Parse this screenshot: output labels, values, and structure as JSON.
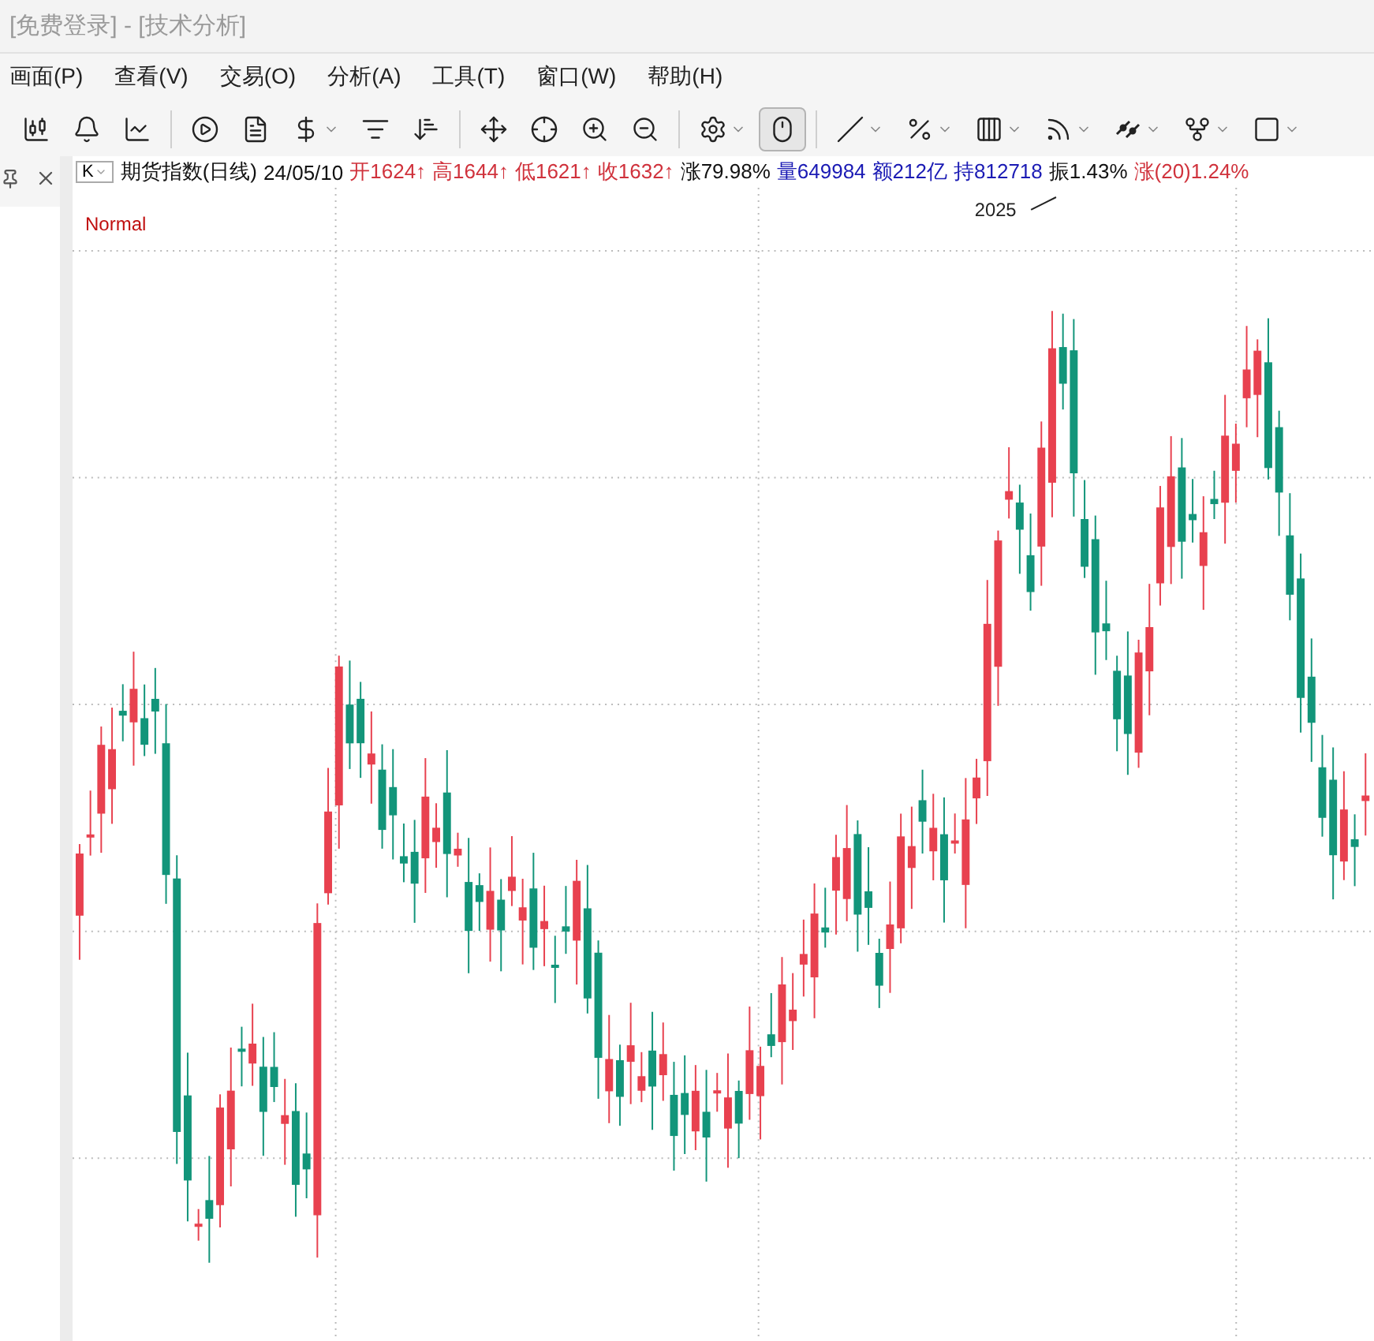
{
  "window": {
    "title": "[免费登录] - [技术分析]"
  },
  "menu": [
    "画面(P)",
    "查看(V)",
    "交易(O)",
    "分析(A)",
    "工具(T)",
    "窗口(W)",
    "帮助(H)"
  ],
  "toolbar": [
    {
      "kind": "candles",
      "dropdown": false,
      "selected": false
    },
    {
      "kind": "bell",
      "dropdown": false,
      "selected": false
    },
    {
      "kind": "linechart",
      "dropdown": false,
      "selected": false
    },
    {
      "kind": "sep"
    },
    {
      "kind": "play",
      "dropdown": false,
      "selected": false
    },
    {
      "kind": "document",
      "dropdown": false,
      "selected": false
    },
    {
      "kind": "dollar",
      "dropdown": true,
      "selected": false
    },
    {
      "kind": "filter",
      "dropdown": false,
      "selected": false
    },
    {
      "kind": "sort",
      "dropdown": false,
      "selected": false
    },
    {
      "kind": "sep"
    },
    {
      "kind": "move",
      "dropdown": false,
      "selected": false
    },
    {
      "kind": "cross",
      "dropdown": false,
      "selected": false
    },
    {
      "kind": "zoomin",
      "dropdown": false,
      "selected": false
    },
    {
      "kind": "zoomout",
      "dropdown": false,
      "selected": false
    },
    {
      "kind": "sep"
    },
    {
      "kind": "settings",
      "dropdown": true,
      "selected": false
    },
    {
      "kind": "mouse",
      "dropdown": false,
      "selected": true
    },
    {
      "kind": "sep"
    },
    {
      "kind": "line",
      "dropdown": true,
      "selected": false
    },
    {
      "kind": "percent",
      "dropdown": true,
      "selected": false
    },
    {
      "kind": "bars",
      "dropdown": true,
      "selected": false
    },
    {
      "kind": "fan",
      "dropdown": true,
      "selected": false
    },
    {
      "kind": "parallel",
      "dropdown": true,
      "selected": false
    },
    {
      "kind": "pitchfork",
      "dropdown": true,
      "selected": false
    },
    {
      "kind": "rectangle",
      "dropdown": true,
      "selected": false
    }
  ],
  "side_panel": {
    "pinned": true
  },
  "info_bar": {
    "period": "K",
    "title": "期货指数(日线)",
    "date": "24/05/10",
    "items": [
      {
        "text": "开1624↑",
        "color": "#d0323c"
      },
      {
        "text": "高1644↑",
        "color": "#d0323c"
      },
      {
        "text": "低1621↑",
        "color": "#d0323c"
      },
      {
        "text": "收1632↑",
        "color": "#d0323c"
      },
      {
        "text": "涨79.98%",
        "color": "#111111"
      },
      {
        "text": "量649984",
        "color": "#1a1ab4"
      },
      {
        "text": "额212亿",
        "color": "#1a1ab4"
      },
      {
        "text": "持812718",
        "color": "#1a1ab4"
      },
      {
        "text": "振1.43%",
        "color": "#111111"
      },
      {
        "text": "涨(20)1.24%",
        "color": "#d0323c"
      }
    ]
  },
  "chart": {
    "legend": "Normal",
    "annotation": "2025"
  }
}
